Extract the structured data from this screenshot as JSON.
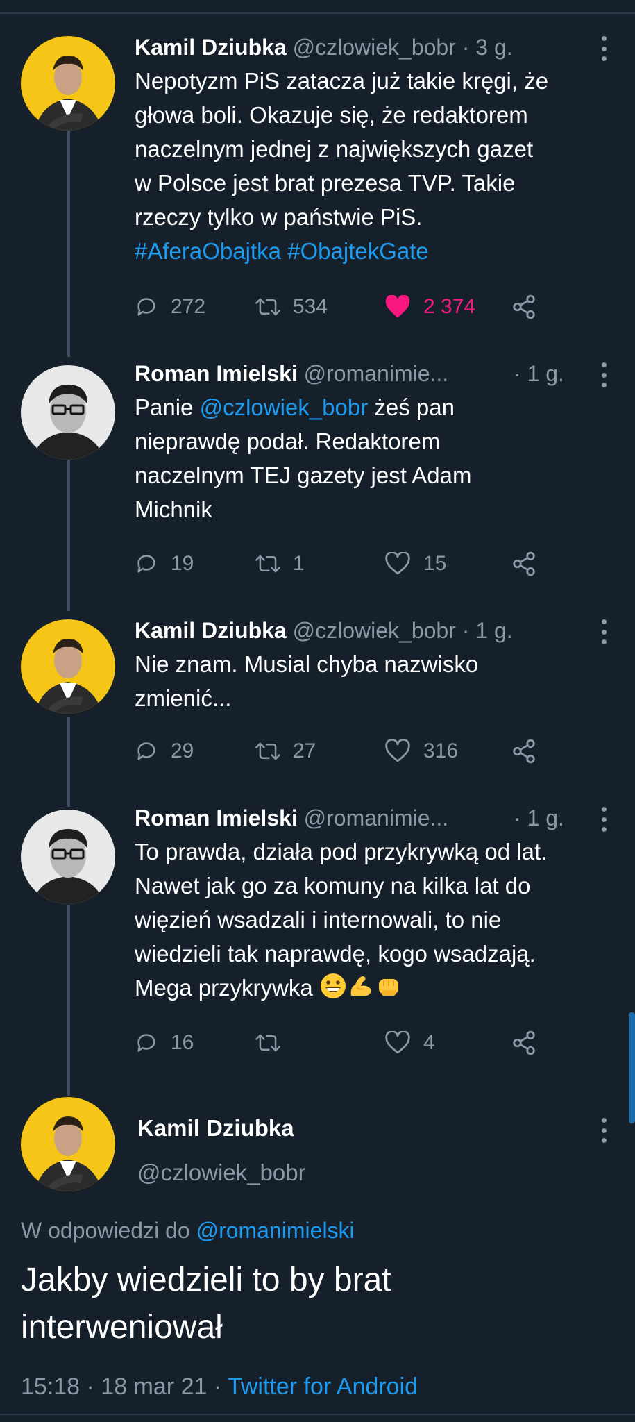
{
  "tweets": [
    {
      "author": "Kamil Dziubka",
      "handle": "@czlowiek_bobr",
      "time": "· 3 g.",
      "text_lines": [
        "Nepotyzm PiS zatacza już takie kręgi, że",
        "głowa boli. Okazuje się, że redaktorem",
        "naczelnym jednej z największych gazet",
        "w Polsce jest brat prezesa TVP. Takie",
        "rzeczy tylko w państwie PiS."
      ],
      "hashtags": "#AferaObajtka #ObajtekGate",
      "replies": "272",
      "retweets": "534",
      "likes": "2 374"
    },
    {
      "author": "Roman Imielski",
      "handle": "@romanimie...",
      "time": "· 1 g.",
      "text_prefix": "Panie ",
      "mention": "@czlowiek_bobr",
      "text_suffix": " żeś pan",
      "text_lines": [
        "nieprawdę podał. Redaktorem",
        "naczelnym TEJ gazety jest Adam",
        "Michnik"
      ],
      "replies": "19",
      "retweets": "1",
      "likes": "15"
    },
    {
      "author": "Kamil Dziubka",
      "handle": "@czlowiek_bobr",
      "time": "· 1 g.",
      "text_lines": [
        "Nie znam. Musial chyba nazwisko",
        "zmienić..."
      ],
      "replies": "29",
      "retweets": "27",
      "likes": "316"
    },
    {
      "author": "Roman Imielski",
      "handle": "@romanimie...",
      "time": "· 1 g.",
      "text_lines": [
        "To prawda, działa pod przykrywką od lat.",
        "Nawet jak go za komuny na kilka lat do",
        "więzień wsadzali i internowali, to nie",
        "wiedzieli tak naprawdę, kogo wsadzają.",
        "Mega przykrywka"
      ],
      "replies": "16",
      "retweets": "",
      "likes": "4"
    }
  ],
  "main": {
    "author": "Kamil Dziubka",
    "handle": "@czlowiek_bobr",
    "reply_prefix": "W odpowiedzi do ",
    "reply_mention": "@romanimielski",
    "text_lines": [
      "Jakby wiedzieli to by brat",
      "interweniował"
    ],
    "time": "15:18 · 18 mar 21 · ",
    "client": "Twitter for Android"
  },
  "colors": {
    "background": "#15202b",
    "link": "#1d9bf0",
    "like": "#f91880",
    "muted": "#8b98a5"
  }
}
